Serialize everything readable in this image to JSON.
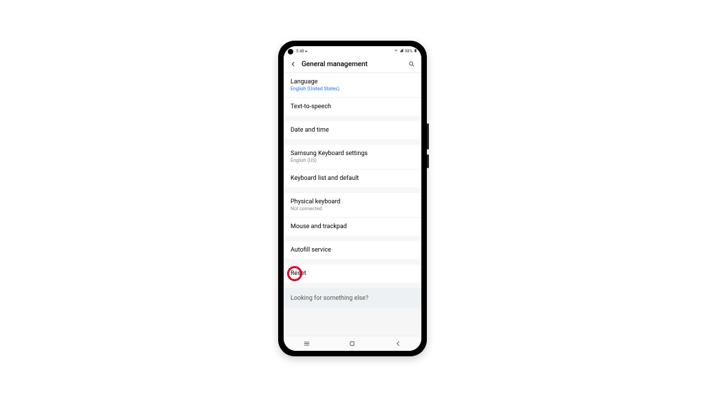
{
  "status": {
    "time": "5:48",
    "battery": "98%"
  },
  "header": {
    "title": "General management"
  },
  "groups": [
    {
      "items": [
        {
          "title": "Language",
          "sub": "English (United States)",
          "subLink": true
        },
        {
          "title": "Text-to-speech"
        }
      ]
    },
    {
      "items": [
        {
          "title": "Date and time"
        }
      ]
    },
    {
      "items": [
        {
          "title": "Samsung Keyboard settings",
          "sub": "English (US)"
        },
        {
          "title": "Keyboard list and default"
        }
      ]
    },
    {
      "items": [
        {
          "title": "Physical keyboard",
          "sub": "Not connected"
        },
        {
          "title": "Mouse and trackpad"
        }
      ]
    },
    {
      "items": [
        {
          "title": "Autofill service"
        }
      ]
    },
    {
      "items": [
        {
          "title": "Reset",
          "highlight": true
        }
      ]
    }
  ],
  "footer": {
    "help": "Looking for something else?"
  }
}
